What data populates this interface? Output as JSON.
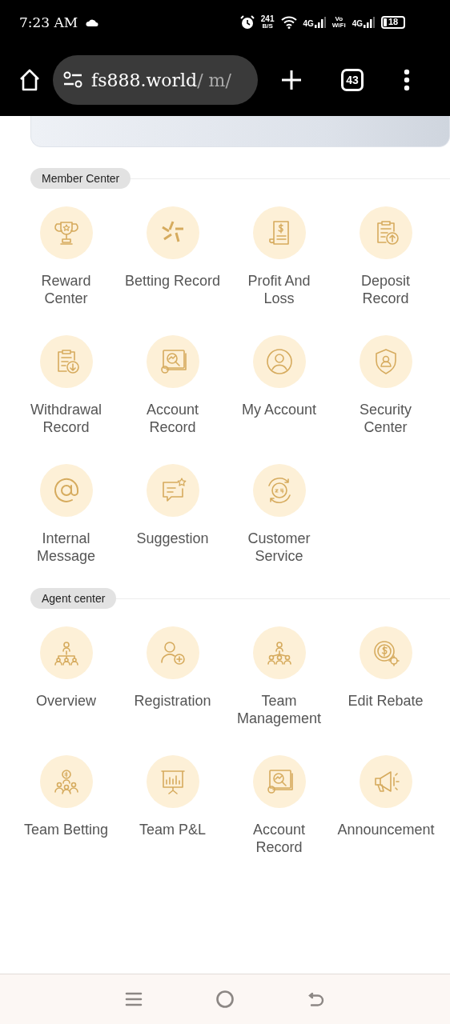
{
  "status_bar": {
    "time": "7:23 AM",
    "speed": "241",
    "speed_unit": "B/S",
    "net1": "4G",
    "volte": "Vo",
    "volte2": "WiFi",
    "net2": "4G",
    "battery": "18"
  },
  "browser": {
    "url_host": "fs888.world",
    "url_path": "/ m/",
    "tab_count": "43"
  },
  "sections": [
    {
      "title": "Member Center",
      "items": [
        {
          "label": "Reward Center"
        },
        {
          "label": "Betting Record"
        },
        {
          "label": "Profit And Loss"
        },
        {
          "label": "Deposit Record"
        },
        {
          "label": "Withdrawal Record"
        },
        {
          "label": "Account Record"
        },
        {
          "label": "My Account"
        },
        {
          "label": "Security Center"
        },
        {
          "label": "Internal Message"
        },
        {
          "label": "Suggestion"
        },
        {
          "label": "Customer Service"
        }
      ]
    },
    {
      "title": "Agent center",
      "items": [
        {
          "label": "Overview"
        },
        {
          "label": "Registration"
        },
        {
          "label": "Team Management"
        },
        {
          "label": "Edit Rebate"
        },
        {
          "label": "Team Betting"
        },
        {
          "label": "Team P&L"
        },
        {
          "label": "Account Record"
        },
        {
          "label": "Announcement"
        }
      ]
    }
  ]
}
